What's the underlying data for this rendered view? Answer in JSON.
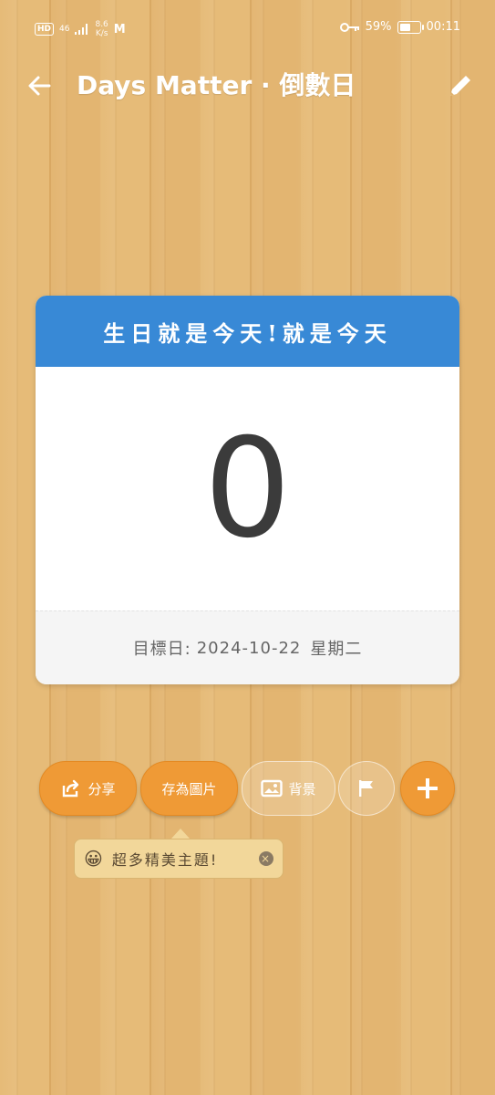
{
  "status_bar": {
    "hd": "HD",
    "network": "46",
    "speed_value": "8.6",
    "speed_unit": "K/s",
    "gmail": "M",
    "battery_percent": "59%",
    "battery_level": 0.59,
    "time": "00:11"
  },
  "app_bar": {
    "title": "Days Matter · 倒數日",
    "back_icon": "arrow-left-icon",
    "edit_icon": "pencil-icon"
  },
  "card": {
    "title": "生日就是今天!就是今天",
    "count": "0",
    "target_label": "目標日:",
    "target_date": "2024-10-22",
    "weekday": "星期二",
    "header_color": "#3889d6"
  },
  "actions": {
    "share": "分享",
    "save_image": "存為圖片",
    "background": "背景"
  },
  "tooltip": {
    "emoji": "😀",
    "text": "超多精美主題!"
  },
  "colors": {
    "accent": "#ef9a36",
    "wood": "#e0b26d"
  }
}
